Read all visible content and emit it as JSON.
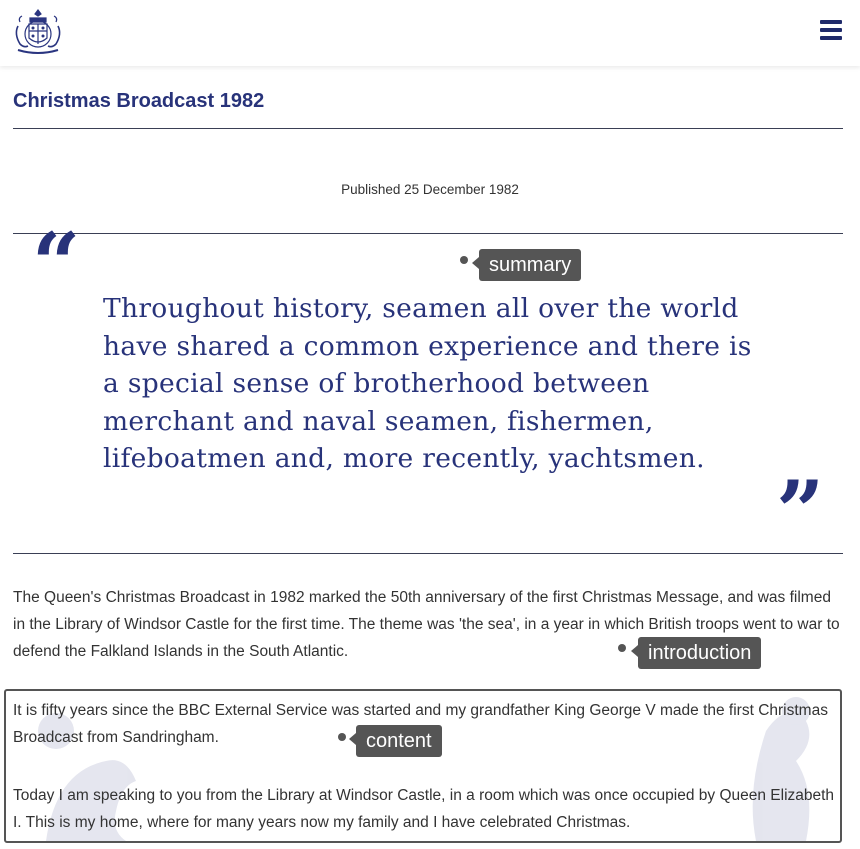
{
  "header": {
    "logo_icon": "royal-coat-of-arms-icon",
    "menu_icon": "hamburger-menu-icon",
    "brand_color": "#28337a"
  },
  "page": {
    "title": "Christmas Broadcast 1982",
    "published": "Published 25 December 1982"
  },
  "pull_quote": {
    "open_mark": "“",
    "close_mark": "”",
    "text": "Throughout history, seamen all over the world have shared a common experience and there is a special sense of brotherhood between merchant and naval seamen, fishermen, lifeboatmen and, more recently, yachtsmen."
  },
  "intro": {
    "text": "The Queen's Christmas Broadcast in 1982 marked the 50th anniversary of the first Christmas Message, and was filmed in the Library of Windsor Castle for the first time. The theme was 'the sea', in a year in which British troops went to war to defend the Falkland Islands in the South Atlantic."
  },
  "content": {
    "paragraphs": [
      "It is fifty years since the BBC External Service was started and my grandfather King George V made the first Christmas Broadcast from Sandringham.",
      "Today I am speaking to you from the Library at Windsor Castle, in a room which was once occupied by Queen Elizabeth I. This is my home, where for many years now my family and I have celebrated Christmas."
    ]
  },
  "annotations": {
    "summary": "summary",
    "introduction": "introduction",
    "content": "content",
    "tag_color": "#555555"
  }
}
